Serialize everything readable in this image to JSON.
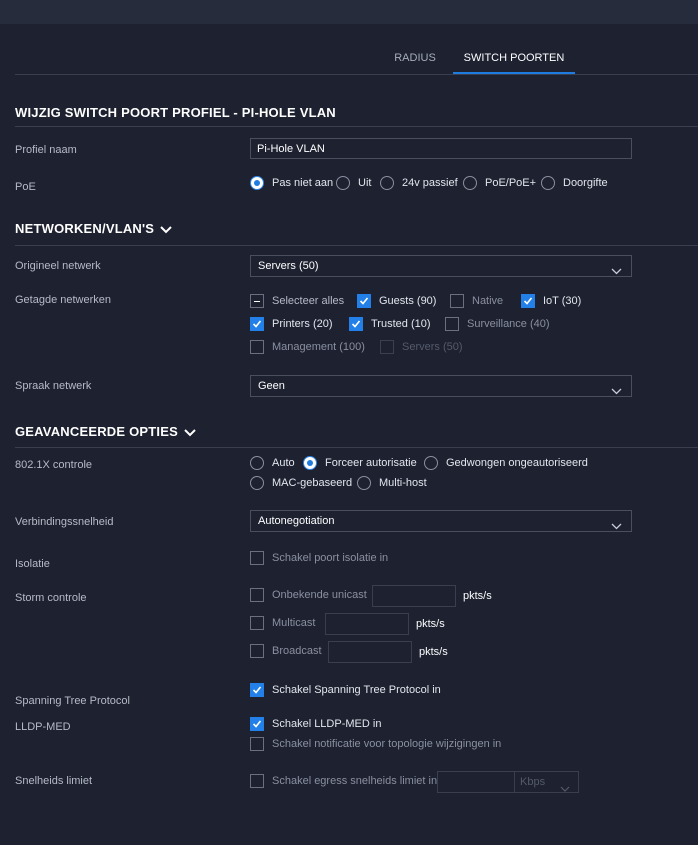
{
  "tabs": [
    {
      "label": "RADIUS",
      "active": false
    },
    {
      "label": "SWITCH POORTEN",
      "active": true
    }
  ],
  "title": "WIJZIG SWITCH POORT PROFIEL - PI-HOLE VLAN",
  "profile": {
    "label": "Profiel naam",
    "value": "Pi-Hole VLAN"
  },
  "poe": {
    "label": "PoE",
    "options": [
      {
        "label": "Pas niet aan",
        "selected": true
      },
      {
        "label": "Uit",
        "selected": false
      },
      {
        "label": "24v passief",
        "selected": false
      },
      {
        "label": "PoE/PoE+",
        "selected": false
      },
      {
        "label": "Doorgifte",
        "selected": false
      }
    ]
  },
  "networks": {
    "section_title": "NETWORKEN/VLAN'S",
    "native_label": "Origineel netwerk",
    "native_value": "Servers (50)",
    "tagged_label": "Getagde netwerken",
    "tagged": [
      {
        "label": "Selecteer alles",
        "state": "partial"
      },
      {
        "label": "Guests (90)",
        "state": "checked"
      },
      {
        "label": "Native",
        "state": "unchecked"
      },
      {
        "label": "IoT (30)",
        "state": "checked"
      },
      {
        "label": "Printers (20)",
        "state": "checked"
      },
      {
        "label": "Trusted (10)",
        "state": "checked"
      },
      {
        "label": "Surveillance (40)",
        "state": "unchecked"
      },
      {
        "label": "Management (100)",
        "state": "unchecked"
      },
      {
        "label": "Servers (50)",
        "state": "disabled"
      }
    ],
    "voice_label": "Spraak netwerk",
    "voice_value": "Geen"
  },
  "advanced": {
    "section_title": "GEAVANCEERDE OPTIES",
    "dot1x": {
      "label": "802.1X controle",
      "options": [
        {
          "label": "Auto",
          "selected": false
        },
        {
          "label": "Forceer autorisatie",
          "selected": true
        },
        {
          "label": "Gedwongen ongeautoriseerd",
          "selected": false
        },
        {
          "label": "MAC-gebaseerd",
          "selected": false
        },
        {
          "label": "Multi-host",
          "selected": false
        }
      ]
    },
    "speed": {
      "label": "Verbindingssnelheid",
      "value": "Autonegotiation"
    },
    "isolation": {
      "label": "Isolatie",
      "option": "Schakel poort isolatie in",
      "checked": false
    },
    "storm": {
      "label": "Storm controle",
      "unit": "pkts/s",
      "items": [
        {
          "label": "Onbekende unicast",
          "checked": false
        },
        {
          "label": "Multicast",
          "checked": false
        },
        {
          "label": "Broadcast",
          "checked": false
        }
      ]
    },
    "stp": {
      "label": "Spanning Tree Protocol",
      "option": "Schakel Spanning Tree Protocol in",
      "checked": true
    },
    "lldp": {
      "label": "LLDP-MED",
      "option": "Schakel LLDP-MED in",
      "checked": true,
      "notify_option": "Schakel notificatie voor topologie wijzigingen in",
      "notify_checked": false
    },
    "rate": {
      "label": "Snelheids limiet",
      "option": "Schakel egress snelheids limiet in",
      "checked": false,
      "unit": "Kbps"
    }
  },
  "colors": {
    "accent": "#2280e8",
    "background": "#1d2130"
  }
}
